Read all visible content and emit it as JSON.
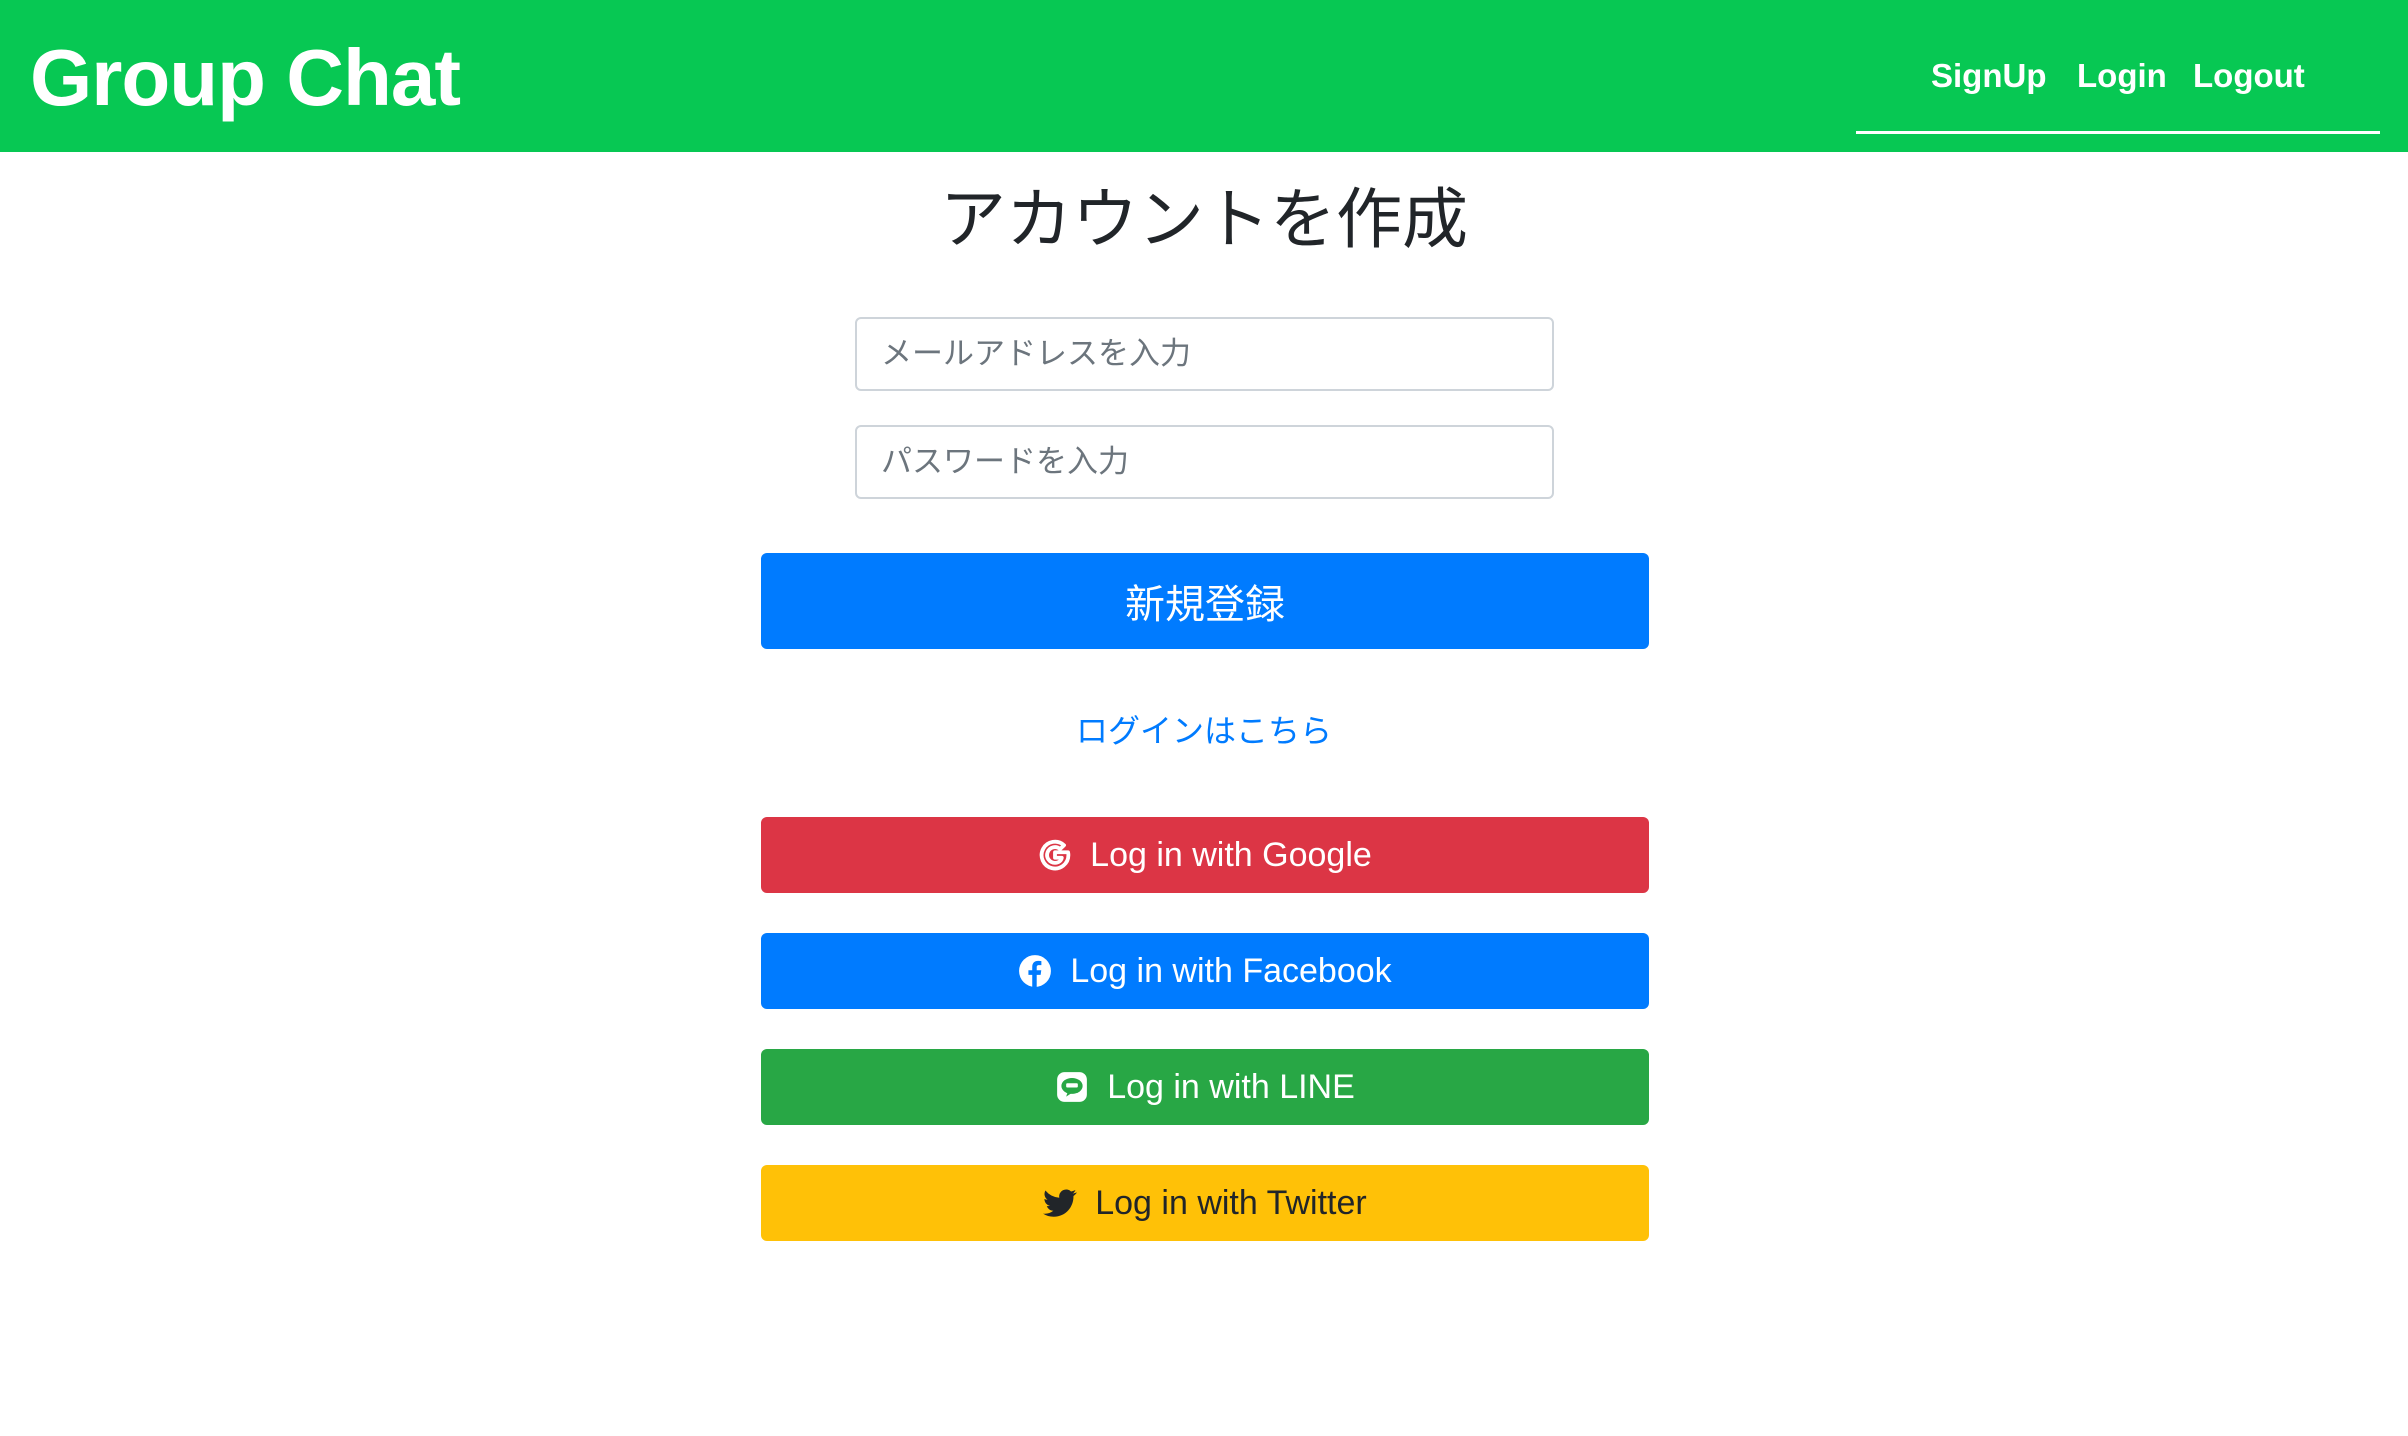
{
  "header": {
    "brand": "Group Chat",
    "nav": {
      "signup": "SignUp",
      "login": "Login",
      "logout": "Logout"
    },
    "background_color": "#07c853"
  },
  "main": {
    "title": "アカウントを作成",
    "email_placeholder": "メールアドレスを入力",
    "password_placeholder": "パスワードを入力",
    "register_button": "新規登録",
    "login_link": "ログインはこちら"
  },
  "social": {
    "google": {
      "label": "Log in with Google",
      "icon": "google-icon",
      "color": "#dc3545"
    },
    "facebook": {
      "label": "Log in with Facebook",
      "icon": "facebook-icon",
      "color": "#007bff"
    },
    "line": {
      "label": "Log in with LINE",
      "icon": "line-icon",
      "color": "#28a745"
    },
    "twitter": {
      "label": "Log in with Twitter",
      "icon": "twitter-icon",
      "color": "#ffc107"
    }
  }
}
